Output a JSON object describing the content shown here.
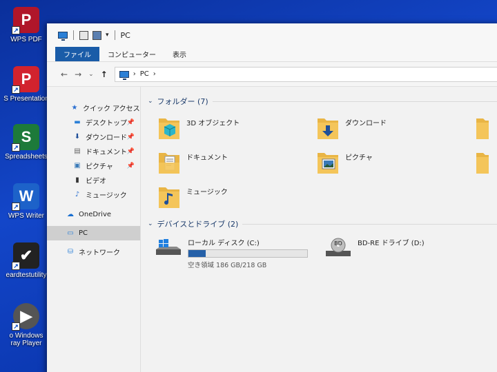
{
  "desktop": {
    "icons": [
      {
        "label": "WPS PDF",
        "letter": "P",
        "color": "#b0162a"
      },
      {
        "label": "S Presentation",
        "letter": "P",
        "color": "#d2232e"
      },
      {
        "label": "Spreadsheets",
        "letter": "S",
        "color": "#1d7a3a"
      },
      {
        "label": "WPS Writer",
        "letter": "W",
        "color": "#1d62c9"
      },
      {
        "label": "eardtestutility",
        "letter": "✔",
        "color": "#222222"
      },
      {
        "label": "o Windows\nray Player",
        "letter": "▶",
        "color": "#555555"
      }
    ]
  },
  "window": {
    "title": "PC",
    "tabs": [
      "ファイル",
      "コンピューター",
      "表示"
    ],
    "address": {
      "back": "←",
      "forward": "→",
      "recent": "⌄",
      "up": "↑",
      "path": "PC",
      "sep": "›"
    },
    "nav": {
      "items": [
        {
          "label": "クイック アクセス",
          "icon": "★"
        },
        {
          "label": "デスクトップ",
          "icon": "▬"
        },
        {
          "label": "ダウンロード",
          "icon": "⬇"
        },
        {
          "label": "ドキュメント",
          "icon": "▤"
        },
        {
          "label": "ピクチャ",
          "icon": "▣"
        },
        {
          "label": "ビデオ",
          "icon": "▮"
        },
        {
          "label": "ミュージック",
          "icon": "♪"
        },
        {
          "label": "OneDrive",
          "icon": "☁"
        },
        {
          "label": "PC",
          "icon": "▭"
        },
        {
          "label": "ネットワーク",
          "icon": "⛁"
        }
      ],
      "pin": "📌"
    },
    "folders": {
      "header": "フォルダー (7)",
      "items": [
        "3D オブジェクト",
        "ダウンロード",
        "ドキュメント",
        "ピクチャ",
        "ミュージック"
      ]
    },
    "devices": {
      "header": "デバイスとドライブ (2)",
      "local": {
        "name": "ローカル ディスク (C:)",
        "free": "空き領域 186 GB/218 GB",
        "used_fraction": 0.147
      },
      "bd": {
        "name": "BD-RE ドライブ (D:)",
        "disc_label": "BD"
      }
    }
  }
}
